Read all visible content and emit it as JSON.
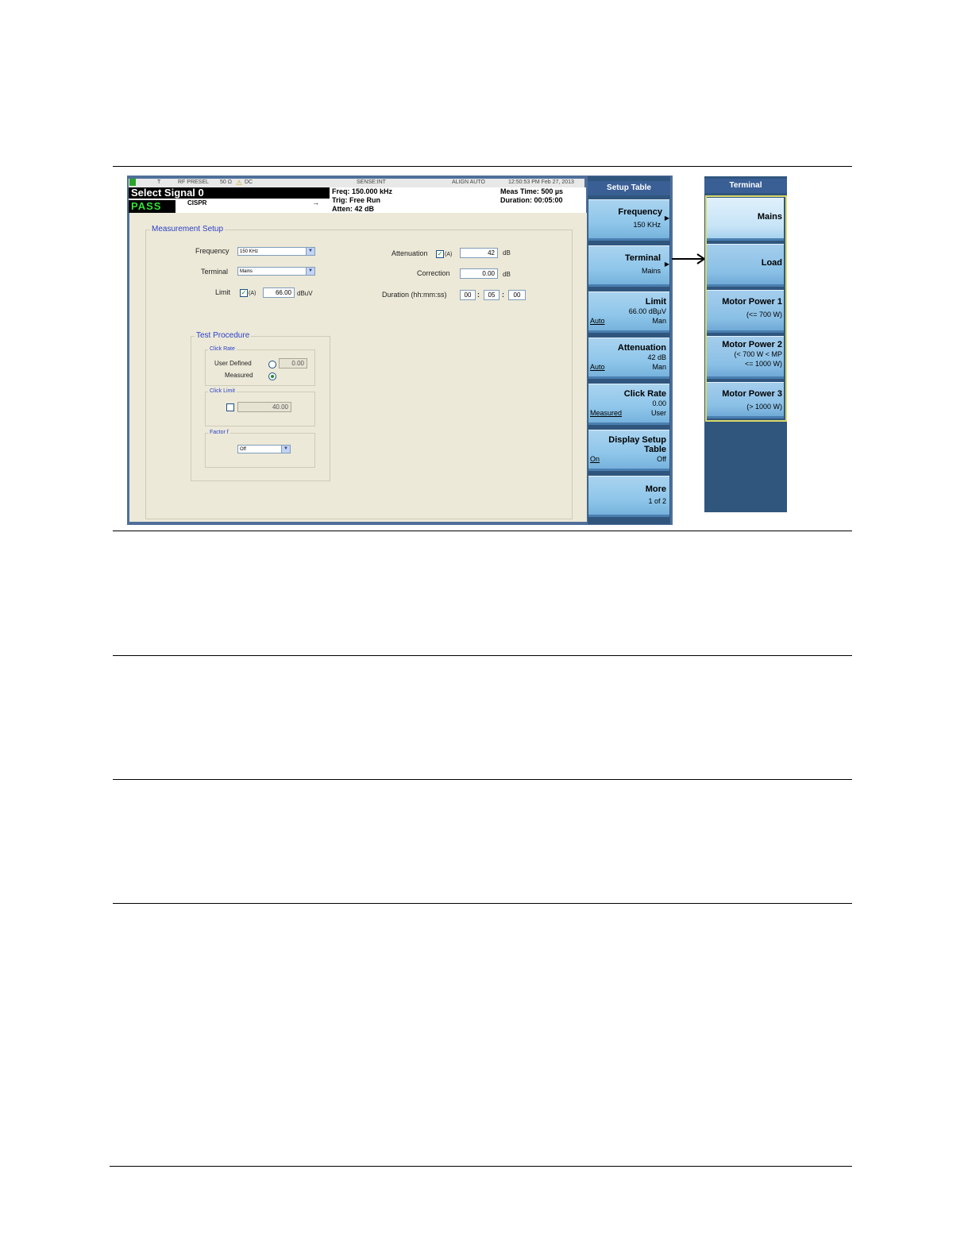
{
  "status_bar": {
    "items": [
      "T",
      "RF PRESEL",
      "50 Ω",
      "DC",
      "SENSE:INT",
      "ALIGN AUTO",
      "12:50:53 PM Feb 27, 2013"
    ]
  },
  "info": {
    "title": "Select Signal 0",
    "pass": "PASS",
    "mode": "CISPR",
    "freq": "Freq: 150.000 kHz",
    "trig": "Trig: Free Run",
    "atten": "Atten: 42 dB",
    "meas_time": "Meas Time: 500 µs",
    "duration": "Duration: 00:05:00"
  },
  "measurement_setup": {
    "title": "Measurement Setup",
    "frequency_label": "Frequency",
    "frequency_value": "150 KHz",
    "terminal_label": "Terminal",
    "terminal_value": "Mains",
    "limit_label": "Limit",
    "limit_auto": "(A)",
    "limit_value": "66.00",
    "limit_unit": "dBuV",
    "attenuation_label": "Attenuation",
    "attenuation_auto": "(A)",
    "attenuation_value": "42",
    "attenuation_unit": "dB",
    "correction_label": "Correction",
    "correction_value": "0.00",
    "correction_unit": "dB",
    "duration_label": "Duration (hh:mm:ss)",
    "duration_h": "00",
    "duration_m": "05",
    "duration_s": "00"
  },
  "test_procedure": {
    "title": "Test Procedure",
    "click_rate_title": "Click Rate",
    "user_defined_label": "User Defined",
    "user_defined_value": "0.00",
    "measured_label": "Measured",
    "click_limit_title": "Click Limit",
    "click_limit_value": "40.00",
    "factor_title": "Factor f",
    "factor_value": "Off"
  },
  "setup_table_menu": {
    "title": "Setup Table",
    "keys": [
      {
        "label": "Frequency",
        "value": "150 KHz"
      },
      {
        "label": "Terminal",
        "value": "Mains"
      },
      {
        "label": "Limit",
        "value": "66.00 dBµV",
        "left": "Auto",
        "right": "Man"
      },
      {
        "label": "Attenuation",
        "value": "42 dB",
        "left": "Auto",
        "right": "Man"
      },
      {
        "label": "Click Rate",
        "value": "0.00",
        "left": "Measured",
        "right": "User"
      },
      {
        "label": "Display Setup",
        "label2": "Table",
        "left": "On",
        "right": "Off"
      },
      {
        "label": "More",
        "value": "1 of 2"
      }
    ]
  },
  "terminal_menu": {
    "title": "Terminal",
    "keys": [
      {
        "label": "Mains"
      },
      {
        "label": "Load"
      },
      {
        "label": "Motor Power 1",
        "sub": "(<= 700 W)"
      },
      {
        "label": "Motor Power 2",
        "sub": "(< 700 W < MP",
        "sub2": "<= 1000 W)"
      },
      {
        "label": "Motor Power 3",
        "sub": "(> 1000 W)"
      }
    ]
  }
}
